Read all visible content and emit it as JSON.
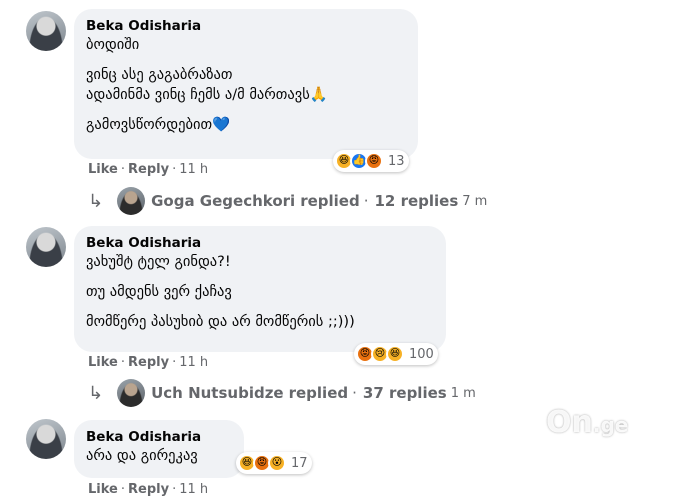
{
  "comments": [
    {
      "author": "Beka Odisharia",
      "lines": [
        "ბოდიში",
        "ვინც ასე გაგაბრაზათ",
        "ადამინმა ვინც ჩემს ა/მ მართავს🙏",
        "გამოვსწორდებით💙"
      ],
      "reactions": {
        "icons": [
          "haha-icon",
          "like-icon",
          "angry-icon"
        ],
        "count": "13"
      },
      "actions": {
        "like": "Like",
        "reply": "Reply",
        "time": "11 h"
      },
      "replied": {
        "name": "Goga Gegechkori",
        "text": "replied",
        "count": "12 replies",
        "time": "7 m"
      }
    },
    {
      "author": "Beka Odisharia",
      "lines": [
        "ვახუშტ ტელ გინდა?!",
        "თუ ამდენს ვერ ქაჩავ",
        "მომწერე პასუხიბ და არ მომწერის ;;)))"
      ],
      "reactions": {
        "icons": [
          "angry-icon",
          "sad-icon",
          "haha-icon"
        ],
        "count": "100"
      },
      "actions": {
        "like": "Like",
        "reply": "Reply",
        "time": "11 h"
      },
      "replied": {
        "name": "Uch Nutsubidze",
        "text": "replied",
        "count": "37 replies",
        "time": "1 m"
      }
    },
    {
      "author": "Beka Odisharia",
      "lines": [
        "არა და გირეკავ"
      ],
      "reactions": {
        "icons": [
          "haha-icon",
          "angry-icon",
          "wow-icon"
        ],
        "count": "17"
      },
      "actions": {
        "like": "Like",
        "reply": "Reply",
        "time": "11 h"
      }
    }
  ],
  "watermark": {
    "main": "On",
    "suffix": ".ge"
  },
  "colors": {
    "bubble": "#f0f2f5",
    "secondary_text": "#65676b",
    "like_blue": "#1877f2",
    "angry_orange": "#e9710f",
    "haha_yellow": "#f7b125"
  }
}
